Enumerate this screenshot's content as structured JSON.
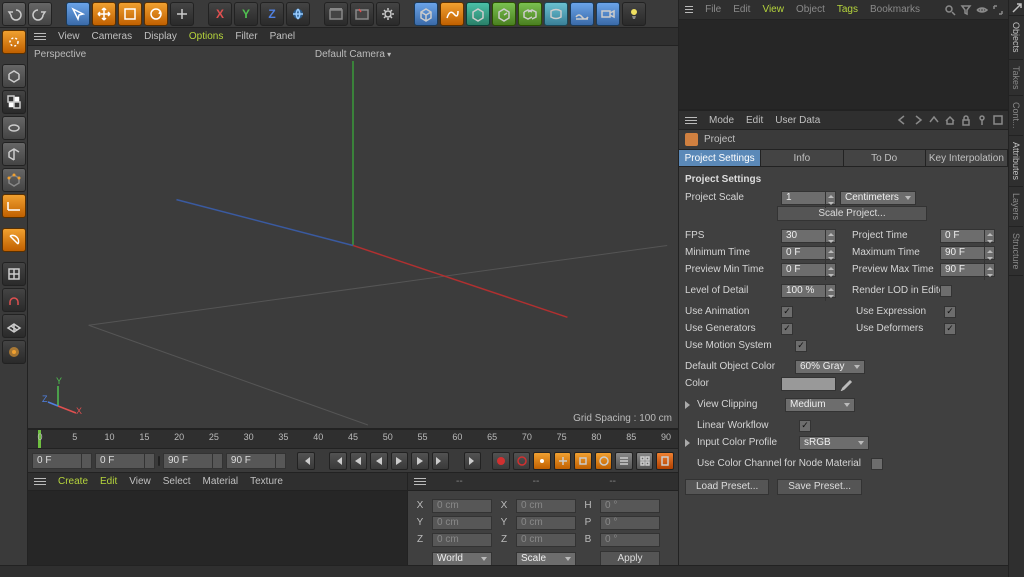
{
  "top_menu_right": {
    "file": "File",
    "edit": "Edit",
    "view": "View",
    "object": "Object",
    "tags": "Tags",
    "bookmarks": "Bookmarks"
  },
  "right_tabs": {
    "objects": "Objects",
    "takes": "Takes",
    "content": "Cont...",
    "attributes": "Attributes",
    "layers": "Layers",
    "structure": "Structure"
  },
  "viewport_menu": {
    "view": "View",
    "cameras": "Cameras",
    "display": "Display",
    "options": "Options",
    "filter": "Filter",
    "panel": "Panel"
  },
  "viewport": {
    "label": "Perspective",
    "camera": "Default Camera",
    "grid": "Grid Spacing : 100 cm"
  },
  "gizmo": {
    "x": "X",
    "y": "Y",
    "z": "Z"
  },
  "ruler_ticks": [
    "0",
    "5",
    "10",
    "15",
    "20",
    "25",
    "30",
    "35",
    "40",
    "45",
    "50",
    "55",
    "60",
    "65",
    "70",
    "75",
    "80",
    "85",
    "90"
  ],
  "timeline": {
    "cur": "0 F",
    "from": "0 F",
    "to": "90 F",
    "to2": "90 F"
  },
  "attr_menu": {
    "mode": "Mode",
    "edit": "Edit",
    "user_data": "User Data"
  },
  "attr_title": "Project",
  "attr_tabs": {
    "settings": "Project Settings",
    "info": "Info",
    "todo": "To Do",
    "key": "Key Interpolation"
  },
  "attr": {
    "section": "Project Settings",
    "scale_lab": "Project Scale",
    "scale_val": "1",
    "scale_unit": "Centimeters",
    "scale_btn": "Scale Project...",
    "fps_lab": "FPS",
    "fps_val": "30",
    "ptime_lab": "Project Time",
    "ptime_val": "0 F",
    "min_lab": "Minimum Time",
    "min_val": "0 F",
    "max_lab": "Maximum Time",
    "max_val": "90 F",
    "pmin_lab": "Preview Min Time",
    "pmin_val": "0 F",
    "pmax_lab": "Preview Max Time",
    "pmax_val": "90 F",
    "lod_lab": "Level of Detail",
    "lod_val": "100 %",
    "rlod_lab": "Render LOD in Editor",
    "anim_lab": "Use Animation",
    "expr_lab": "Use Expression",
    "gen_lab": "Use Generators",
    "def_lab": "Use Deformers",
    "motion_lab": "Use Motion System",
    "docolor_lab": "Default Object Color",
    "docolor_val": "60% Gray",
    "color_lab": "Color",
    "clip_lab": "View Clipping",
    "clip_val": "Medium",
    "linear_lab": "Linear Workflow",
    "icp_lab": "Input Color Profile",
    "icp_val": "sRGB",
    "uccnm_lab": "Use Color Channel for Node Material",
    "load": "Load Preset...",
    "save": "Save Preset..."
  },
  "bot_left_menu": {
    "create": "Create",
    "edit": "Edit",
    "view": "View",
    "select": "Select",
    "material": "Material",
    "texture": "Texture"
  },
  "bot_right_head": {
    "c1": "--",
    "c2": "--",
    "c3": "--"
  },
  "coords": {
    "x": "X",
    "y": "Y",
    "z": "Z",
    "h": "H",
    "p": "P",
    "b": "B",
    "xv": "0 cm",
    "yv": "0 cm",
    "zv": "0 cm",
    "zv2": "0 cm",
    "hv": "0 °",
    "pv": "0 °",
    "bv": "0 °",
    "world": "World",
    "scale": "Scale",
    "apply": "Apply"
  }
}
